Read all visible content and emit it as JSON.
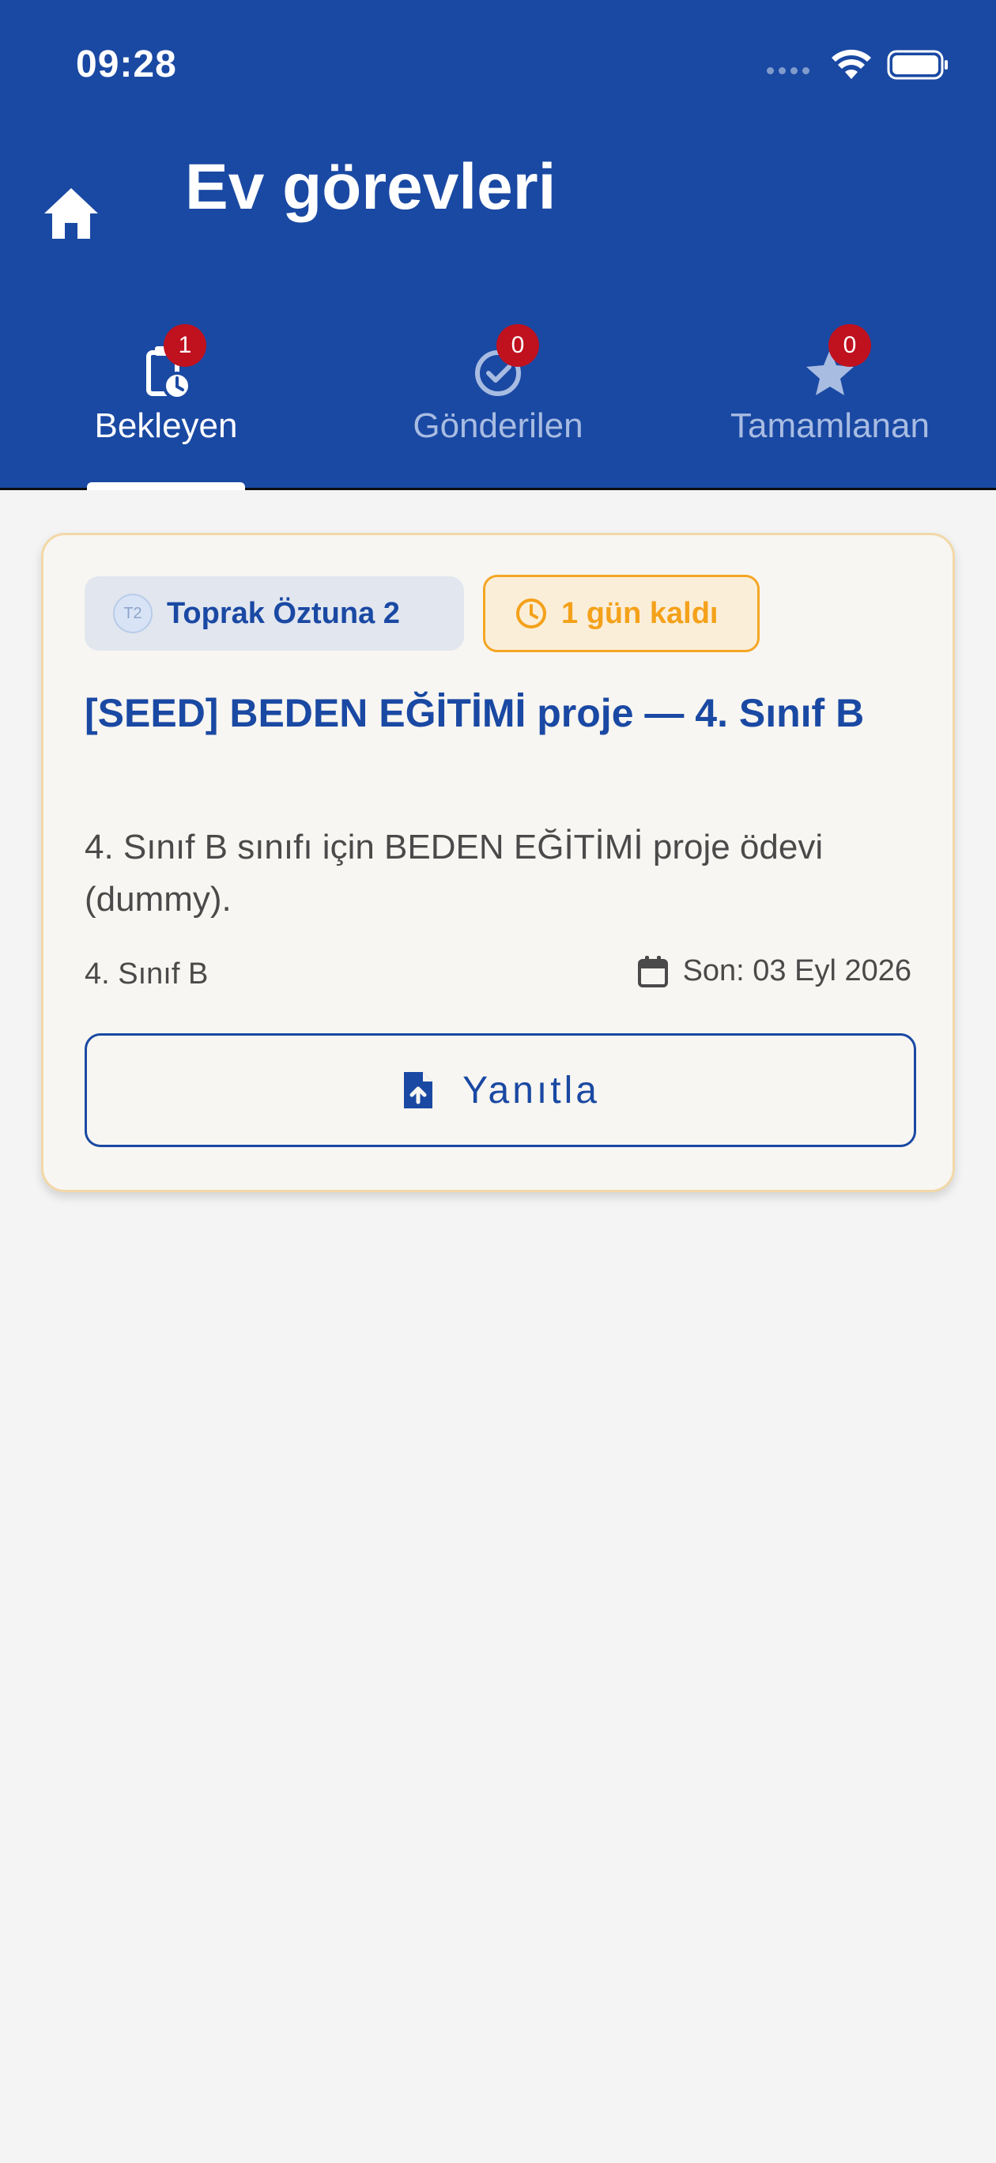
{
  "status_bar": {
    "time": "09:28"
  },
  "header": {
    "title": "Ev görevleri"
  },
  "tabs": [
    {
      "label": "Bekleyen",
      "badge": "1",
      "active": true,
      "icon": "clipboard-clock-icon"
    },
    {
      "label": "Gönderilen",
      "badge": "0",
      "active": false,
      "icon": "check-circle-icon"
    },
    {
      "label": "Tamamlanan",
      "badge": "0",
      "active": false,
      "icon": "star-icon"
    }
  ],
  "task": {
    "teacher_initials": "T2",
    "teacher_name": "Toprak Öztuna 2",
    "deadline_label": "1 gün kaldı",
    "title": "[SEED] BEDEN EĞİTİMİ proje — 4. Sınıf B",
    "description": "4. Sınıf B sınıfı için BEDEN EĞİTİMİ proje ödevi (dummy).",
    "class_name": "4. Sınıf B",
    "due": "Son: 03 Eyl 2026",
    "action_label": "Yanıtla"
  },
  "colors": {
    "primary": "#1a49a3",
    "badge": "#c0111f",
    "warning": "#f4a623",
    "background": "#f4f4f4"
  }
}
